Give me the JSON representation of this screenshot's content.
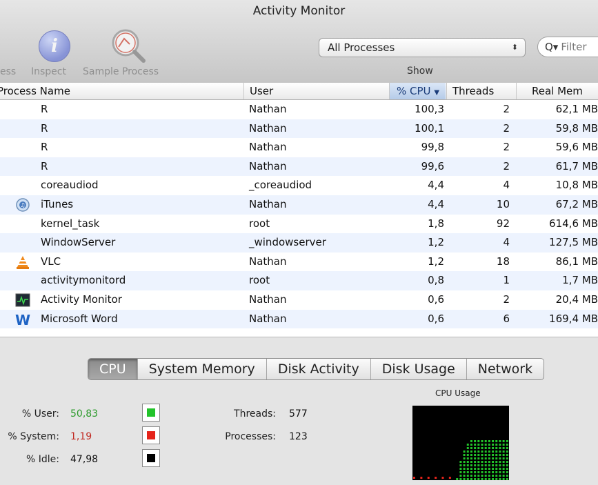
{
  "window": {
    "title": "Activity Monitor"
  },
  "toolbar": {
    "quit_label_partial": "ess",
    "inspect_label": "Inspect",
    "sample_label": "Sample Process",
    "show_select_value": "All Processes",
    "show_label": "Show",
    "filter_placeholder": "Filter"
  },
  "table": {
    "columns": {
      "name": "Process Name",
      "user": "User",
      "cpu": "% CPU",
      "threads": "Threads",
      "mem": "Real Mem"
    },
    "sorted_column": "cpu",
    "rows": [
      {
        "name": "R",
        "user": "Nathan",
        "cpu": "100,3",
        "threads": "2",
        "mem": "62,1 MB",
        "icon": "none"
      },
      {
        "name": "R",
        "user": "Nathan",
        "cpu": "100,1",
        "threads": "2",
        "mem": "59,8 MB",
        "icon": "none"
      },
      {
        "name": "R",
        "user": "Nathan",
        "cpu": "99,8",
        "threads": "2",
        "mem": "59,6 MB",
        "icon": "none"
      },
      {
        "name": "R",
        "user": "Nathan",
        "cpu": "99,6",
        "threads": "2",
        "mem": "61,7 MB",
        "icon": "none"
      },
      {
        "name": "coreaudiod",
        "user": "_coreaudiod",
        "cpu": "4,4",
        "threads": "4",
        "mem": "10,8 MB",
        "icon": "none"
      },
      {
        "name": "iTunes",
        "user": "Nathan",
        "cpu": "4,4",
        "threads": "10",
        "mem": "67,2 MB",
        "icon": "itunes-icon"
      },
      {
        "name": "kernel_task",
        "user": "root",
        "cpu": "1,8",
        "threads": "92",
        "mem": "614,6 MB",
        "icon": "none"
      },
      {
        "name": "WindowServer",
        "user": "_windowserver",
        "cpu": "1,2",
        "threads": "4",
        "mem": "127,5 MB",
        "icon": "none"
      },
      {
        "name": "VLC",
        "user": "Nathan",
        "cpu": "1,2",
        "threads": "18",
        "mem": "86,1 MB",
        "icon": "vlc-icon"
      },
      {
        "name": "activitymonitord",
        "user": "root",
        "cpu": "0,8",
        "threads": "1",
        "mem": "1,7 MB",
        "icon": "none"
      },
      {
        "name": "Activity Monitor",
        "user": "Nathan",
        "cpu": "0,6",
        "threads": "2",
        "mem": "20,4 MB",
        "icon": "activity-monitor-icon"
      },
      {
        "name": "Microsoft Word",
        "user": "Nathan",
        "cpu": "0,6",
        "threads": "6",
        "mem": "169,4 MB",
        "icon": "word-icon"
      }
    ]
  },
  "bottom": {
    "tabs": [
      "CPU",
      "System Memory",
      "Disk Activity",
      "Disk Usage",
      "Network"
    ],
    "active_tab": "CPU",
    "user_label": "% User:",
    "user_value": "50,83",
    "system_label": "% System:",
    "system_value": "1,19",
    "idle_label": "% Idle:",
    "idle_value": "47,98",
    "threads_label": "Threads:",
    "threads_value": "577",
    "processes_label": "Processes:",
    "processes_value": "123",
    "graph_title": "CPU Usage",
    "colors": {
      "user": "#22c32a",
      "system": "#e5231a",
      "idle": "#000000"
    },
    "cpu_history_user_fraction": [
      0.0,
      0.0,
      0.0,
      0.0,
      0.0,
      0.0,
      0.0,
      0.0,
      0.0,
      0.0,
      0.0,
      0.0,
      0.05,
      0.28,
      0.4,
      0.5,
      0.55,
      0.55,
      0.55,
      0.55,
      0.55,
      0.55,
      0.55,
      0.55,
      0.55,
      0.55,
      0.55
    ]
  }
}
